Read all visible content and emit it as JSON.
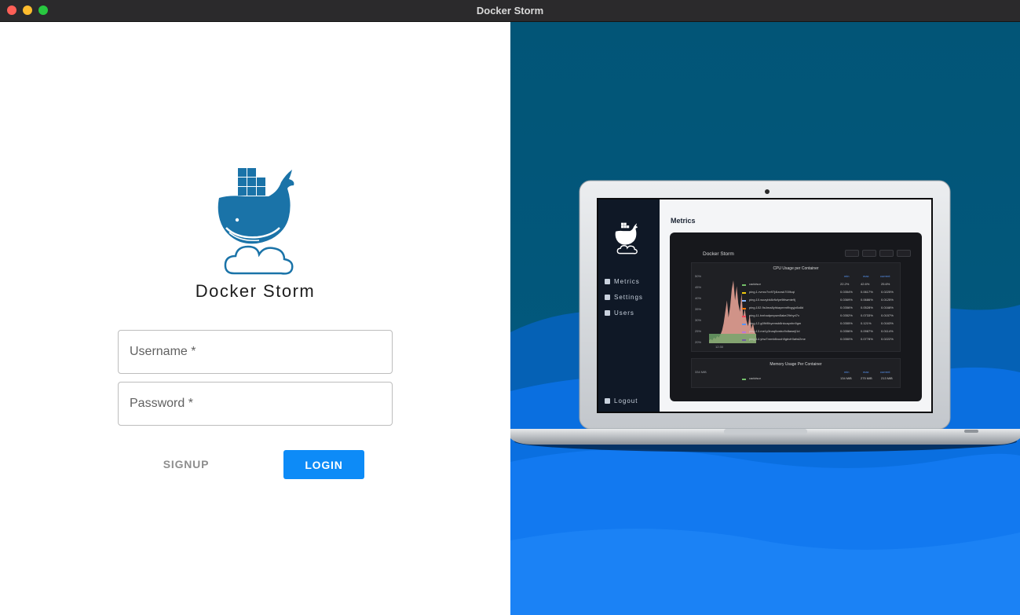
{
  "window": {
    "title": "Docker Storm"
  },
  "login": {
    "app_name": "Docker Storm",
    "username_placeholder": "Username *",
    "password_placeholder": "Password *",
    "signup_label": "SIGNUP",
    "login_label": "LOGIN"
  },
  "preview": {
    "main_title": "Metrics",
    "nav": [
      "Metrics",
      "Settings",
      "Users"
    ],
    "logout_label": "Logout",
    "dashboard_title": "Docker Storm",
    "cpu_panel_title": "CPU Usage per Container",
    "mem_panel_title": "Memory Usage Per Container",
    "legend_headers": [
      "min",
      "max",
      "current"
    ],
    "cpu_yaxis": [
      "50%",
      "45%",
      "40%",
      "35%",
      "30%",
      "25%",
      "20%"
    ],
    "xaxis_label": "12:30",
    "cpu_rows": [
      {
        "name": "cadvisor",
        "color": "#73bf69",
        "min": "22.2%",
        "max": "42.6%",
        "current": "25.6%"
      },
      {
        "name": "ping.1.rvmrz7nr97j4lzcwk700fcqi",
        "color": "#f2cc0c",
        "min": "0.0354%",
        "max": "0.0617%",
        "current": "0.0225%"
      },
      {
        "name": "ping.10.wozybk8vfizfye9lttwmte9j",
        "color": "#8ab8ff",
        "min": "0.0369%",
        "max": "0.0686%",
        "current": "0.0125%"
      },
      {
        "name": "ping.102.9s4ma8yhkaymmt9vgyjz8a8d",
        "color": "#ff780a",
        "min": "0.0356%",
        "max": "0.0528%",
        "current": "0.0168%"
      },
      {
        "name": "ping.11.tvnhadpmpwn5ake29rhyd7x",
        "color": "#f2495c",
        "min": "0.0352%",
        "max": "0.0733%",
        "current": "0.0157%"
      },
      {
        "name": "ping.12.g0fh9lhyemsb8nkcaynhn9gm",
        "color": "#5794f2",
        "min": "0.0355%",
        "max": "0.121%",
        "current": "0.0163%"
      },
      {
        "name": "ping.13.me1y3naq0cwbo9x8awejl1d",
        "color": "#b877d9",
        "min": "0.0356%",
        "max": "0.0987%",
        "current": "0.0114%"
      },
      {
        "name": "ping.14.yhw7nrmb8xuoh9gbvfr0afwl2me",
        "color": "#705da0",
        "min": "0.0350%",
        "max": "0.0778%",
        "current": "0.0222%"
      }
    ],
    "mem_yaxis": "334 MiB",
    "mem_rows": [
      {
        "name": "cadvisor",
        "color": "#73bf69",
        "min": "134 MiB",
        "max": "275 MiB",
        "current": "213 MiB"
      }
    ],
    "chart_series": [
      2,
      3,
      2,
      4,
      3,
      5,
      4,
      6,
      9,
      14,
      22,
      30,
      18,
      26,
      38,
      44,
      30,
      40,
      28,
      22,
      35,
      18,
      24,
      16,
      12,
      20,
      10,
      14,
      8,
      6
    ]
  },
  "colors": {
    "accent": "#0d8bf7",
    "whale": "#1a73a8",
    "bg_dark": "#025577",
    "bg_light": "#0f74ee"
  }
}
